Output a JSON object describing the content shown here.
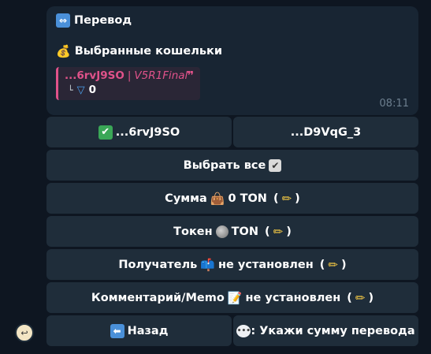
{
  "message": {
    "title": "Перевод",
    "title_icon": "left-right-arrow-icon",
    "wallets_heading": "Выбранные кошельки",
    "wallets_icon": "money-bag-icon",
    "quote": {
      "address": "...6rvJ9SO",
      "separator": "|",
      "version": "V5R1Final",
      "corner_glyph": "└",
      "balance": "0",
      "balance_icon": "ton-icon"
    },
    "time": "08:11"
  },
  "buttons": {
    "wallet1_label": "...6rvJ9SO",
    "wallet2_label": "...D9VqG_3",
    "select_all_label": "Выбрать все",
    "amount_prefix": "Сумма",
    "amount_value": "0 TON",
    "token_prefix": "Токен",
    "token_value": "TON",
    "recipient_prefix": "Получатель",
    "recipient_value": "не установлен",
    "comment_prefix": "Комментарий/Memo",
    "comment_value": "не установлен",
    "back_label": "Назад",
    "hint_label": ": Укажи сумму перевода",
    "paren_open": "(",
    "paren_close": ")"
  },
  "colors": {
    "background": "#0e1621",
    "bubble": "#182533",
    "button": "#1f2d3a",
    "quote_accent": "#e0528a",
    "time": "#6d7f8f"
  }
}
